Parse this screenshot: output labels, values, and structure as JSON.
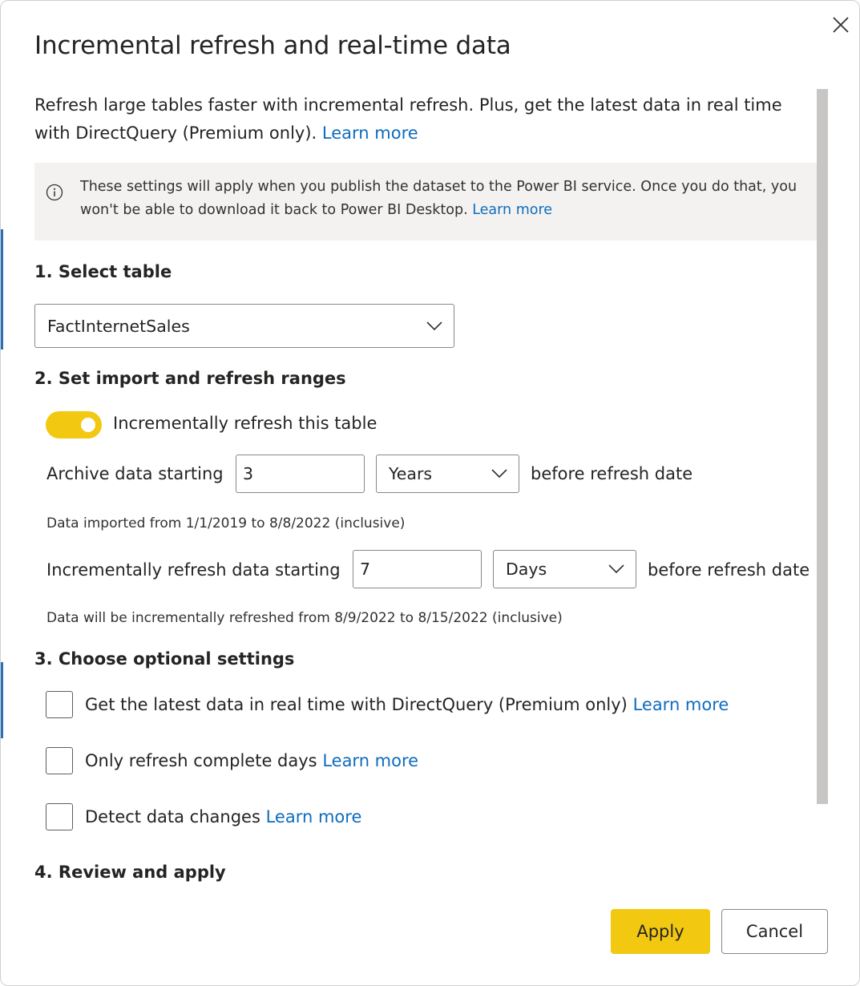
{
  "dialog": {
    "title": "Incremental refresh and real-time data",
    "intro_text": "Refresh large tables faster with incremental refresh. Plus, get the latest data in real time with DirectQuery (Premium only).",
    "intro_link": "Learn more",
    "info_text": "These settings will apply when you publish the dataset to the Power BI service. Once you do that, you won't be able to download it back to Power BI Desktop.",
    "info_link": "Learn more",
    "close_icon": "close-icon"
  },
  "section1": {
    "heading": "1. Select table",
    "table_select": {
      "value": "FactInternetSales"
    }
  },
  "section2": {
    "heading": "2. Set import and refresh ranges",
    "toggle": {
      "label": "Incrementally refresh this table",
      "on": true
    },
    "archive": {
      "label": "Archive data starting",
      "value": "3",
      "unit": "Years",
      "suffix": "before refresh date",
      "hint": "Data imported from 1/1/2019 to 8/8/2022 (inclusive)"
    },
    "incremental": {
      "label": "Incrementally refresh data starting",
      "value": "7",
      "unit": "Days",
      "suffix": "before refresh date",
      "hint": "Data will be incrementally refreshed from 8/9/2022 to 8/15/2022 (inclusive)"
    }
  },
  "section3": {
    "heading": "3. Choose optional settings",
    "options": [
      {
        "label": "Get the latest data in real time with DirectQuery (Premium only)",
        "link": "Learn more",
        "checked": false
      },
      {
        "label": "Only refresh complete days",
        "link": "Learn more",
        "checked": false
      },
      {
        "label": "Detect data changes",
        "link": "Learn more",
        "checked": false
      }
    ]
  },
  "section4": {
    "heading": "4. Review and apply"
  },
  "buttons": {
    "apply": "Apply",
    "cancel": "Cancel"
  },
  "colors": {
    "accent_yellow": "#f2c811",
    "link_blue": "#0f6cbd",
    "info_bg": "#f3f2f1"
  }
}
